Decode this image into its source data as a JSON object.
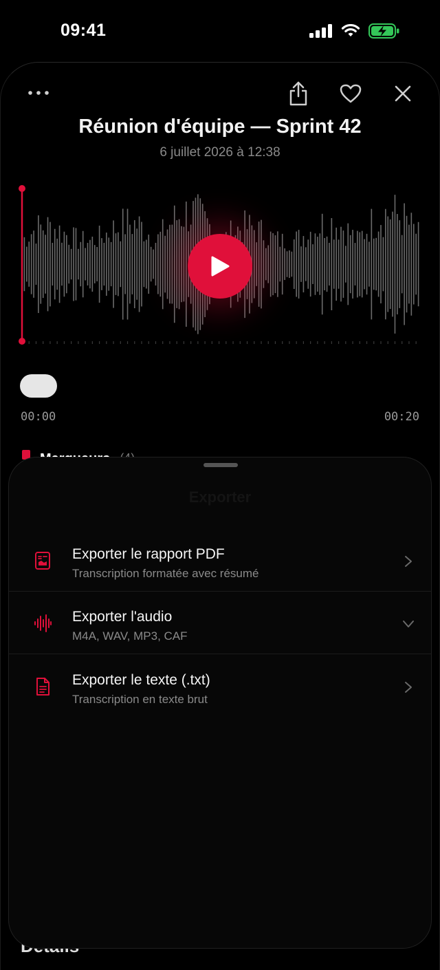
{
  "status": {
    "time": "09:41",
    "icons": [
      "cellular-signal-icon",
      "wifi-icon",
      "battery-charging-icon"
    ]
  },
  "recording": {
    "title": "Réunion d'équipe — Sprint 42",
    "date": "6 juillet 2026 à 12:38",
    "playback_position": 0,
    "time_start": "00:00",
    "time_end": "00:20"
  },
  "markers": {
    "label": "Marqueurs",
    "count": "(4)"
  },
  "details": {
    "label": "Détails"
  },
  "sheet": {
    "title": "Exporter",
    "options": [
      {
        "title": "Exporter le rapport PDF",
        "subtitle": "Transcription formatée avec résumé",
        "icon": "pdf-report-icon",
        "chevron": "chevron-right-icon"
      },
      {
        "title": "Exporter l'audio",
        "subtitle": "M4A, WAV, MP3, CAF",
        "icon": "waveform-icon",
        "chevron": "chevron-down-icon"
      },
      {
        "title": "Exporter le texte (.txt)",
        "subtitle": "Transcription en texte brut",
        "icon": "text-document-icon",
        "chevron": "chevron-right-icon"
      }
    ]
  },
  "colors": {
    "accent": "#e0103a",
    "background": "#000000",
    "sheet": "#070707",
    "waveform": "#6b6b6b",
    "secondary_text": "#8a8a8a"
  }
}
